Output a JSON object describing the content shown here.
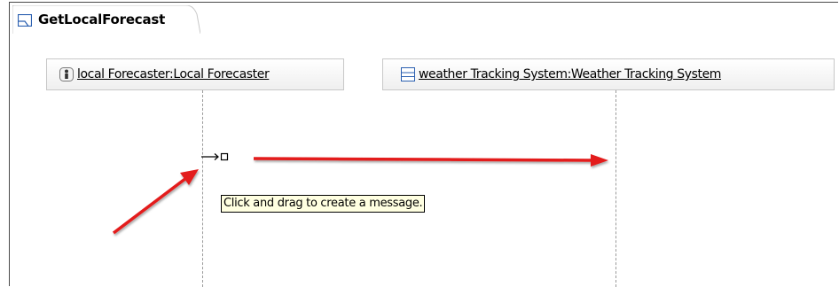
{
  "diagram_tab": {
    "title": "GetLocalForecast",
    "icon": "sequence-diagram-icon"
  },
  "lifelines": [
    {
      "label": "local Forecaster:Local Forecaster",
      "icon": "actor-icon"
    },
    {
      "label": "weather Tracking System:Weather Tracking System",
      "icon": "class-icon"
    }
  ],
  "cursor": {
    "icon": "message-create-cursor-icon"
  },
  "tooltip": {
    "text": "Click and drag to create a message."
  },
  "annotations": {
    "arrow_color": "#e31b1b"
  }
}
